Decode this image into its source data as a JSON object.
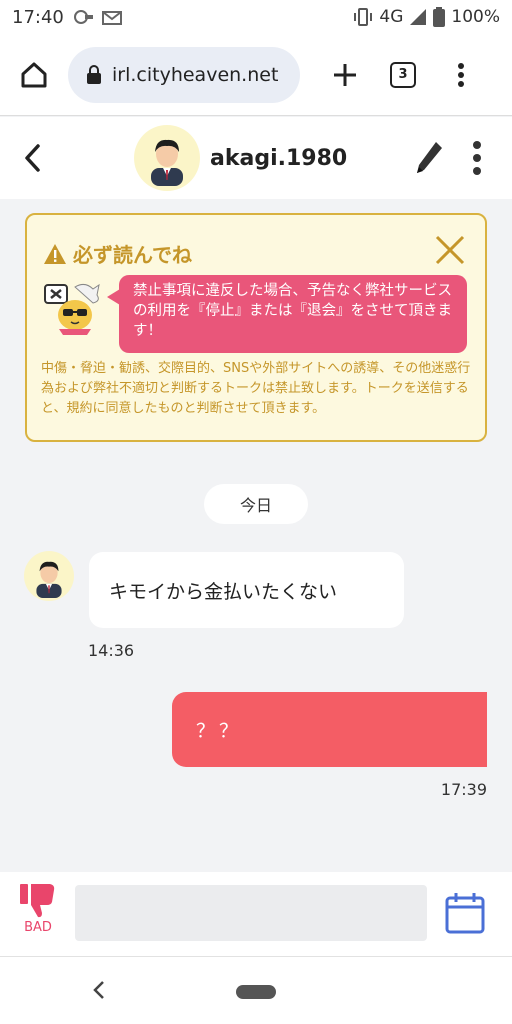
{
  "status_bar": {
    "time": "17:40",
    "network": "4G",
    "battery": "100%",
    "icons": [
      "cast-icon",
      "mail-icon",
      "vibrate-icon",
      "signal-icon",
      "battery-icon"
    ]
  },
  "browser": {
    "url": "irl.cityheaven.net",
    "tab_count": "3",
    "icons": [
      "home-icon",
      "lock-icon",
      "plus-icon",
      "tabs-icon",
      "more-vertical-icon"
    ]
  },
  "chat_header": {
    "username": "akagi.1980",
    "icons": [
      "back-chevron-icon",
      "avatar-icon",
      "pen-icon",
      "more-vertical-icon"
    ]
  },
  "notice": {
    "title": "必ず読んでね",
    "bubble_text": "禁止事項に違反した場合、予告なく弊社サービスの利用を『停止』または『退会』をさせて頂きます！",
    "body_text": "中傷・脅迫・勧誘、交際目的、SNSや外部サイトへの誘導、その他迷惑行為および弊社不適切と判断するトークは禁止致します。トークを送信すると、規約に同意したものと判断させて頂きます。",
    "colors": {
      "border": "#d9b23f",
      "background": "#fdf9df",
      "bubble": "#e9567a"
    }
  },
  "date_label": "今日",
  "messages": [
    {
      "direction": "incoming",
      "text": "キモイから金払いたくない",
      "time": "14:36"
    },
    {
      "direction": "outgoing",
      "text": "？？",
      "time": "17:39"
    }
  ],
  "input_bar": {
    "bad_label": "BAD",
    "input_value": "",
    "icons": [
      "thumbs-down-icon",
      "calendar-icon"
    ],
    "colors": {
      "bad": "#e9456b",
      "calendar": "#4a6fd6"
    }
  },
  "nav": {
    "icons": [
      "nav-back-icon",
      "nav-home-pill"
    ]
  },
  "colors": {
    "outgoing_bubble": "#f45d65",
    "chat_background": "#f2f3f5"
  }
}
